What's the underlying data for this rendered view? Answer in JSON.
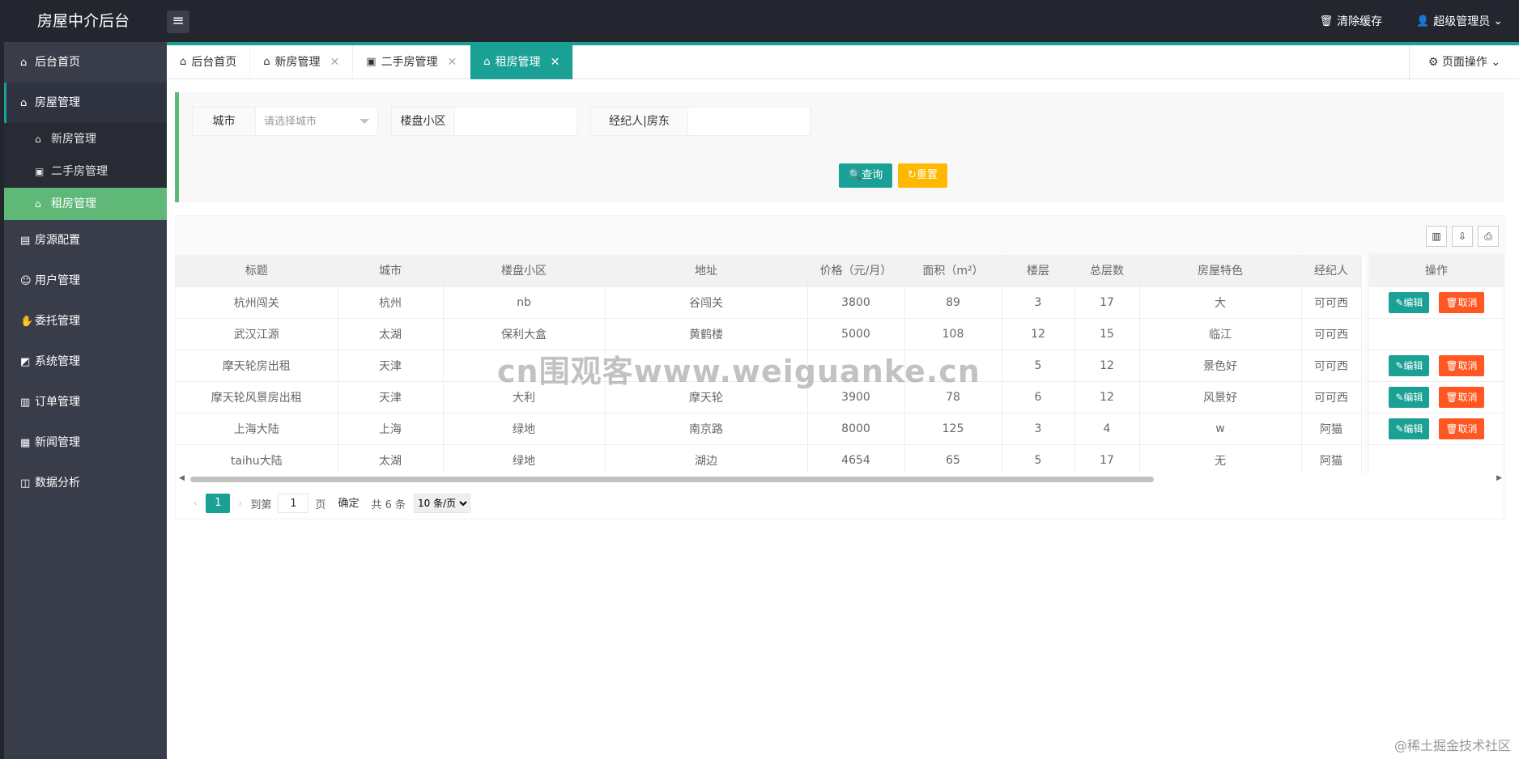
{
  "header": {
    "logo": "房屋中介后台",
    "menu_toggle_icon": "hamburger-icon",
    "clear_cache": "清除缓存",
    "user": "超级管理员"
  },
  "sidebar": {
    "items": [
      {
        "icon": "home-icon",
        "label": "后台首页"
      },
      {
        "icon": "house-icon",
        "label": "房屋管理"
      },
      {
        "icon": "building-icon",
        "label": "房源配置"
      },
      {
        "icon": "user-icon",
        "label": "用户管理"
      },
      {
        "icon": "handshake-icon",
        "label": "委托管理"
      },
      {
        "icon": "settings-icon",
        "label": "系统管理"
      },
      {
        "icon": "order-icon",
        "label": "订单管理"
      },
      {
        "icon": "news-icon",
        "label": "新闻管理"
      },
      {
        "icon": "chart-icon",
        "label": "数据分析"
      }
    ],
    "sub_items": [
      {
        "label": "新房管理"
      },
      {
        "label": "二手房管理"
      },
      {
        "label": "租房管理"
      }
    ]
  },
  "tabs": [
    {
      "label": "后台首页"
    },
    {
      "label": "新房管理"
    },
    {
      "label": "二手房管理"
    },
    {
      "label": "租房管理"
    }
  ],
  "page_ops": "页面操作",
  "search": {
    "city_label": "城市",
    "city_placeholder": "请选择城市",
    "estate_label": "楼盘小区",
    "agent_label": "经纪人|房东",
    "query": "查询",
    "reset": "重置"
  },
  "table": {
    "headers": [
      "标题",
      "城市",
      "楼盘小区",
      "地址",
      "价格（元/月）",
      "面积（m²）",
      "楼层",
      "总层数",
      "房屋特色",
      "经纪人"
    ],
    "ops_header": "操作",
    "rows": [
      [
        "杭州闯关",
        "杭州",
        "nb",
        "谷闯关",
        "3800",
        "89",
        "3",
        "17",
        "大",
        "可可西"
      ],
      [
        "武汉江源",
        "太湖",
        "保利大盒",
        "黄鹤楼",
        "5000",
        "108",
        "12",
        "15",
        "临江",
        "可可西"
      ],
      [
        "摩天轮房出租",
        "天津",
        "",
        "",
        "",
        "",
        "5",
        "12",
        "景色好",
        "可可西"
      ],
      [
        "摩天轮风景房出租",
        "天津",
        "大利",
        "摩天轮",
        "3900",
        "78",
        "6",
        "12",
        "风景好",
        "可可西"
      ],
      [
        "上海大陆",
        "上海",
        "绿地",
        "南京路",
        "8000",
        "125",
        "3",
        "4",
        "w",
        "阿猫"
      ],
      [
        "taihu大陆",
        "太湖",
        "绿地",
        "湖边",
        "4654",
        "65",
        "5",
        "17",
        "无",
        "阿猫"
      ]
    ],
    "edit": "编辑",
    "cancel": "取消"
  },
  "pager": {
    "current": "1",
    "goto": "到第",
    "page_value": "1",
    "page_unit": "页",
    "confirm": "确定",
    "total": "共 6 条",
    "size": "10 条/页"
  },
  "watermark": "cn围观客www.weiguanke.cn",
  "corner_watermark": "@稀土掘金技术社区",
  "colors": {
    "accent": "#1aa094",
    "active_sub": "#5fb878",
    "reset": "#ffb800",
    "cancel": "#ff5722"
  }
}
